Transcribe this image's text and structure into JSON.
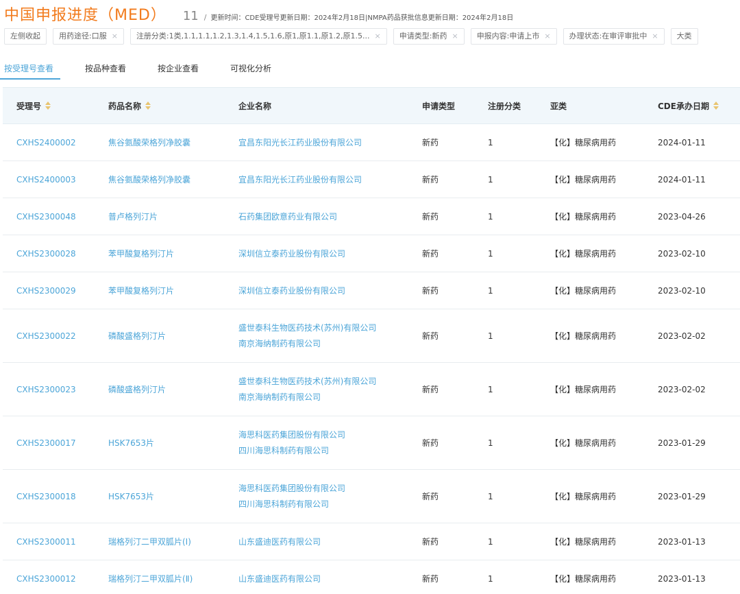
{
  "header": {
    "title": "中国申报进度（MED）",
    "count": "11",
    "slash": "/",
    "update_text": "更新时间：CDE受理号更新日期：2024年2月18日|NMPA药品获批信息更新日期：2024年2月18日"
  },
  "filters": {
    "collapse_label": "左侧收起",
    "chips": [
      {
        "label": "用药途径:口服"
      },
      {
        "label": "注册分类:1类,1.1,1.1,1.2,1.3,1.4,1.5,1.6,原1,原1.1,原1.2,原1.5..."
      },
      {
        "label": "申请类型:新药"
      },
      {
        "label": "申报内容:申请上市"
      },
      {
        "label": "办理状态:在审评审批中"
      }
    ],
    "overflow_label": "大类"
  },
  "tabs": [
    {
      "label": "按受理号查看",
      "active": true
    },
    {
      "label": "按品种查看",
      "active": false
    },
    {
      "label": "按企业查看",
      "active": false
    },
    {
      "label": "可视化分析",
      "active": false
    }
  ],
  "table": {
    "columns": {
      "acceptance_no": "受理号",
      "drug_name": "药品名称",
      "company": "企业名称",
      "app_type": "申请类型",
      "reg_class": "注册分类",
      "subclass": "亚类",
      "cde_date": "CDE承办日期"
    },
    "rows": [
      {
        "no": "CXHS2400002",
        "drug": "焦谷氨酸荣格列净胶囊",
        "companies": [
          "宜昌东阳光长江药业股份有限公司"
        ],
        "type": "新药",
        "class": "1",
        "sub": "【化】糖尿病用药",
        "date": "2024-01-11"
      },
      {
        "no": "CXHS2400003",
        "drug": "焦谷氨酸荣格列净胶囊",
        "companies": [
          "宜昌东阳光长江药业股份有限公司"
        ],
        "type": "新药",
        "class": "1",
        "sub": "【化】糖尿病用药",
        "date": "2024-01-11"
      },
      {
        "no": "CXHS2300048",
        "drug": "普卢格列汀片",
        "companies": [
          "石药集团欧意药业有限公司"
        ],
        "type": "新药",
        "class": "1",
        "sub": "【化】糖尿病用药",
        "date": "2023-04-26"
      },
      {
        "no": "CXHS2300028",
        "drug": "苯甲酸复格列汀片",
        "companies": [
          "深圳信立泰药业股份有限公司"
        ],
        "type": "新药",
        "class": "1",
        "sub": "【化】糖尿病用药",
        "date": "2023-02-10"
      },
      {
        "no": "CXHS2300029",
        "drug": "苯甲酸复格列汀片",
        "companies": [
          "深圳信立泰药业股份有限公司"
        ],
        "type": "新药",
        "class": "1",
        "sub": "【化】糖尿病用药",
        "date": "2023-02-10"
      },
      {
        "no": "CXHS2300022",
        "drug": "磷酸盛格列汀片",
        "companies": [
          "盛世泰科生物医药技术(苏州)有限公司",
          "南京海纳制药有限公司"
        ],
        "type": "新药",
        "class": "1",
        "sub": "【化】糖尿病用药",
        "date": "2023-02-02"
      },
      {
        "no": "CXHS2300023",
        "drug": "磷酸盛格列汀片",
        "companies": [
          "盛世泰科生物医药技术(苏州)有限公司",
          "南京海纳制药有限公司"
        ],
        "type": "新药",
        "class": "1",
        "sub": "【化】糖尿病用药",
        "date": "2023-02-02"
      },
      {
        "no": "CXHS2300017",
        "drug": "HSK7653片",
        "companies": [
          "海思科医药集团股份有限公司",
          "四川海思科制药有限公司"
        ],
        "type": "新药",
        "class": "1",
        "sub": "【化】糖尿病用药",
        "date": "2023-01-29"
      },
      {
        "no": "CXHS2300018",
        "drug": "HSK7653片",
        "companies": [
          "海思科医药集团股份有限公司",
          "四川海思科制药有限公司"
        ],
        "type": "新药",
        "class": "1",
        "sub": "【化】糖尿病用药",
        "date": "2023-01-29"
      },
      {
        "no": "CXHS2300011",
        "drug": "瑞格列汀二甲双胍片(Ⅰ)",
        "companies": [
          "山东盛迪医药有限公司"
        ],
        "type": "新药",
        "class": "1",
        "sub": "【化】糖尿病用药",
        "date": "2023-01-13"
      },
      {
        "no": "CXHS2300012",
        "drug": "瑞格列汀二甲双胍片(Ⅱ)",
        "companies": [
          "山东盛迪医药有限公司"
        ],
        "type": "新药",
        "class": "1",
        "sub": "【化】糖尿病用药",
        "date": "2023-01-13"
      }
    ]
  }
}
